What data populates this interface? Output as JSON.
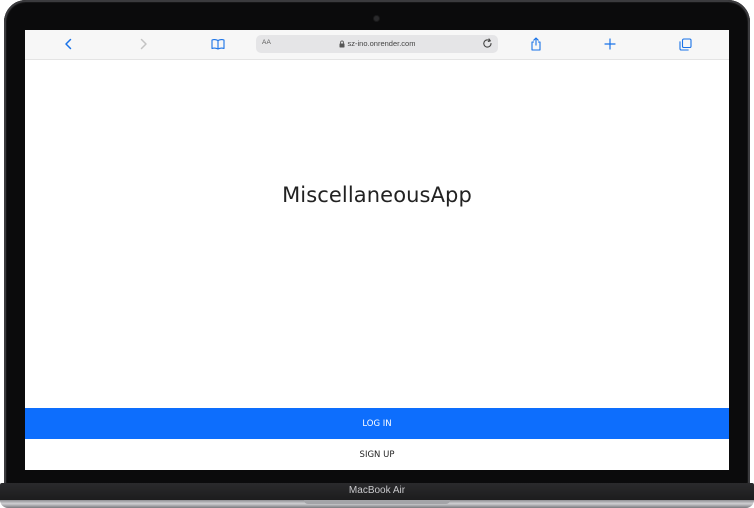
{
  "browser": {
    "address_bar": {
      "text_size_label": "AA",
      "url": "sz-ino.onrender.com"
    },
    "icons": {
      "back": "chevron-left-icon",
      "forward": "chevron-right-icon",
      "bookmarks": "book-icon",
      "reload": "reload-icon",
      "share": "share-icon",
      "new_tab": "plus-icon",
      "tabs": "tabs-icon"
    },
    "accent_color": "#1a73e8"
  },
  "page": {
    "title": "MiscellaneousApp",
    "login_label": "LOG IN",
    "signup_label": "SIGN UP",
    "login_color": "#0d6efd"
  },
  "device": {
    "label": "MacBook Air"
  }
}
